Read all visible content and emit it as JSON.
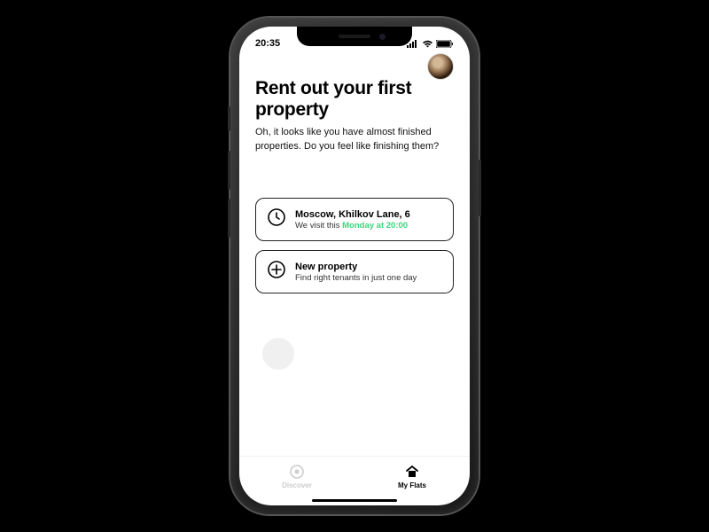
{
  "statusBar": {
    "time": "20:35"
  },
  "header": {
    "title": "Rent out your first property",
    "subtitle": "Oh, it looks like you have almost finished properties. Do you feel like finishing them?"
  },
  "cards": {
    "pending": {
      "title": "Moscow, Khilkov Lane, 6",
      "prefix": "We visit this ",
      "highlight": "Monday at 20:00"
    },
    "newProperty": {
      "title": "New property",
      "subtitle": "Find right tenants in just one day"
    }
  },
  "tabs": {
    "discover": "Discover",
    "myflats": "My Flats"
  }
}
